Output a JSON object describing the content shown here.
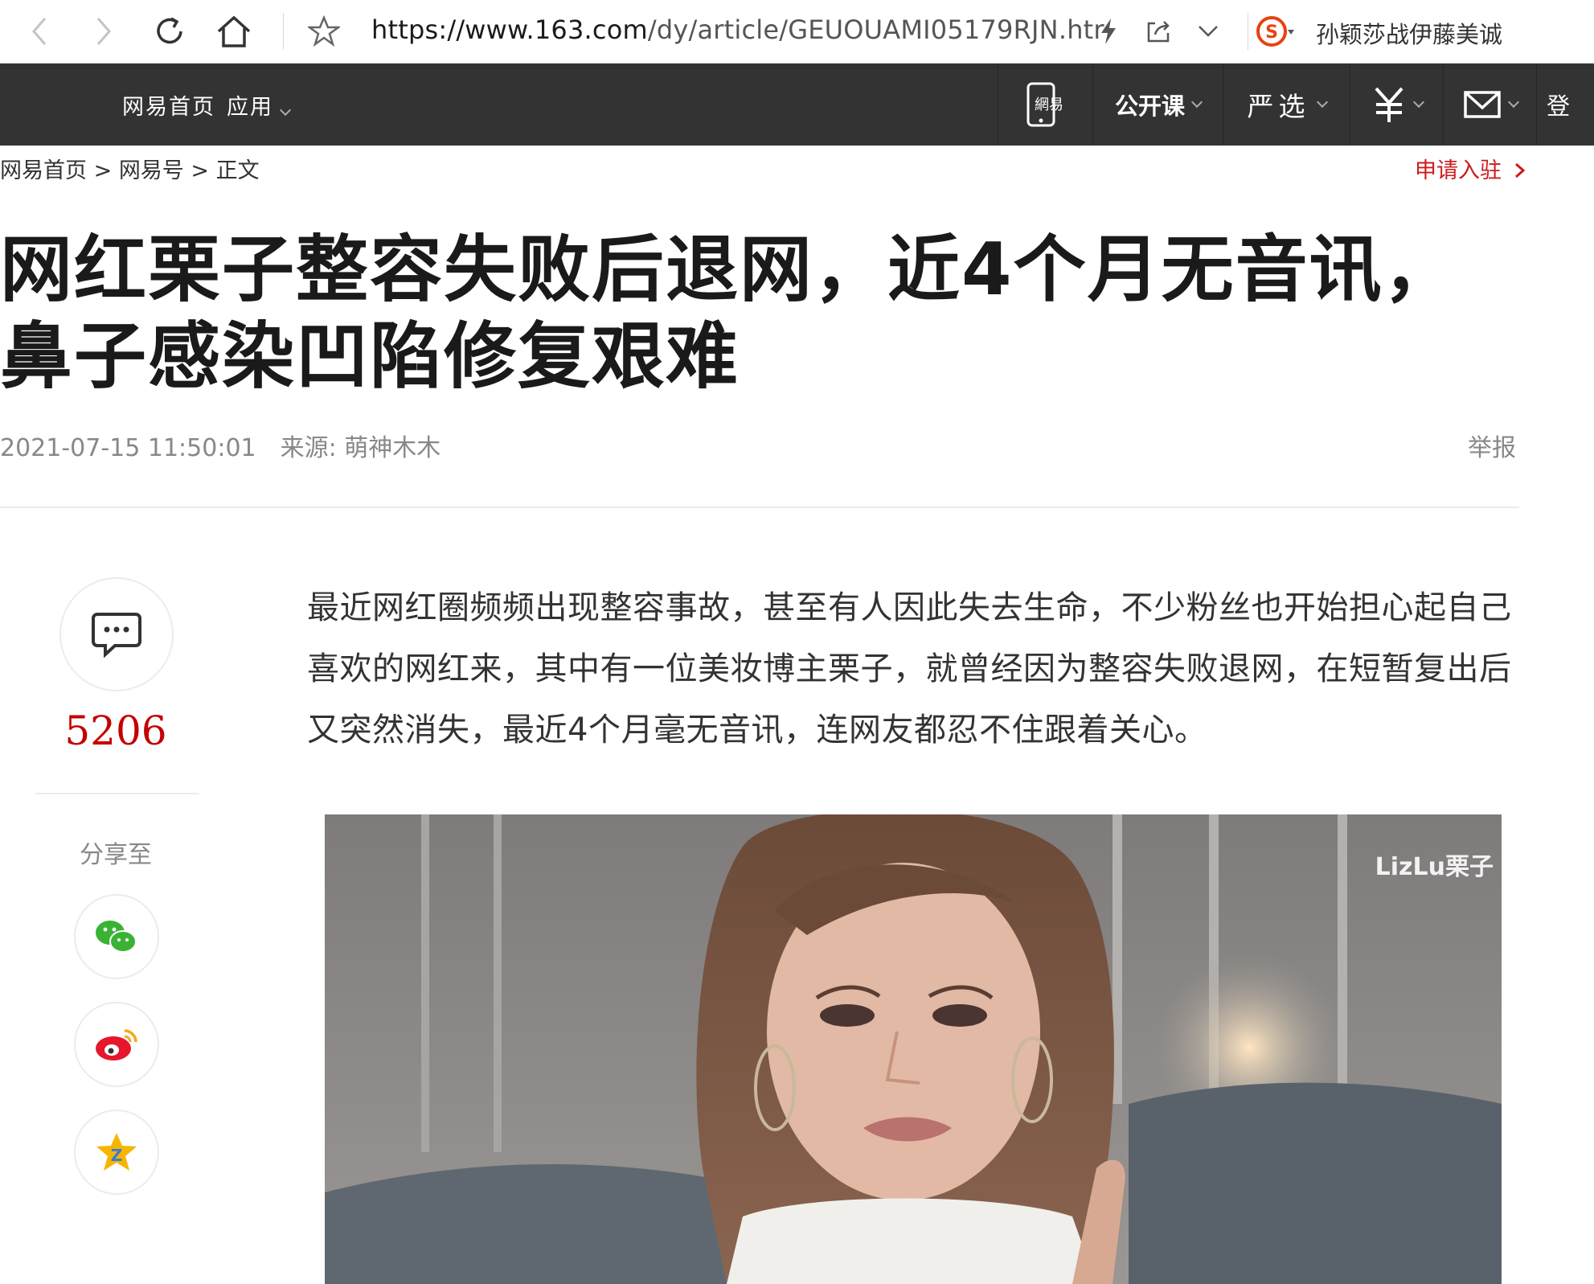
{
  "browser": {
    "url_host": "https://www.163.com",
    "url_path": "/dy/article/GEUOUAMI05179RJN.htr",
    "search_hint": "孙颖莎战伊藤美诚",
    "icons": [
      "back-arrow-icon",
      "forward-arrow-icon",
      "reload-icon",
      "home-icon",
      "star-icon",
      "lightning-icon",
      "share-icon",
      "chevron-down-icon",
      "sogou-logo-icon"
    ]
  },
  "topbar": {
    "home_link": "网易首页",
    "apps_link": "应用",
    "mobile_label": "網易",
    "open_course": "公开课",
    "yanxuan": "严选",
    "login": "登"
  },
  "breadcrumb": {
    "home": "网易首页",
    "sep": ">",
    "section": "网易号",
    "current": "正文",
    "apply": "申请入驻"
  },
  "article": {
    "title": "网红栗子整容失败后退网，近4个月无音讯，鼻子感染凹陷修复艰难",
    "datetime": "2021-07-15 11:50:01",
    "source": "来源: 萌神木木",
    "report": "举报",
    "paragraph": "最近网红圈频频出现整容事故，甚至有人因此失去生命，不少粉丝也开始担心起自己喜欢的网红来，其中有一位美妆博主栗子，就曾经因为整容失败退网，在短暂复出后又突然消失，最近4个月毫无音讯，连网友都忍不住跟着关心。",
    "image_watermark": "LizLu栗子"
  },
  "social": {
    "comment_count": "5206",
    "share_label": "分享至",
    "share_targets": [
      "wechat-icon",
      "weibo-icon",
      "qzone-icon"
    ]
  },
  "colors": {
    "accent_red": "#cc1b1b",
    "topbar_bg": "#333333"
  }
}
